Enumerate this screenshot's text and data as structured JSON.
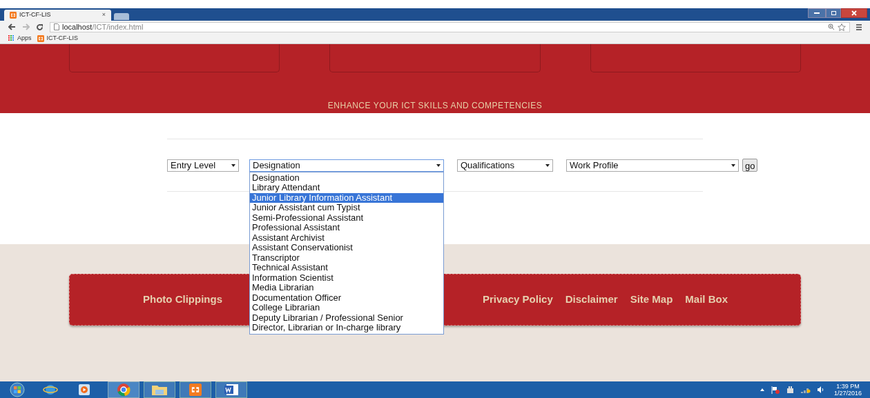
{
  "browser": {
    "tabs": [
      {
        "title": "ICT-CF-LIS",
        "close": "×",
        "selected": true
      },
      {
        "selected": false
      }
    ],
    "url_host": "localhost",
    "url_path": "/ICT/index.html",
    "bookmarks": [
      {
        "label": "Apps",
        "kind": "apps"
      },
      {
        "label": "ICT-CF-LIS",
        "kind": "site"
      }
    ]
  },
  "banner": {
    "tagline": "ENHANCE YOUR ICT SKILLS AND COMPETENCIES"
  },
  "filters": [
    {
      "value": "Entry Level",
      "expanded": false
    },
    {
      "value": "Designation",
      "expanded": true,
      "options": [
        {
          "label": "Designation",
          "highlighted": false
        },
        {
          "label": "Library Attendant",
          "highlighted": false
        },
        {
          "label": "Junior Library Information Assistant",
          "highlighted": true
        },
        {
          "label": "Junior Assistant cum Typist",
          "highlighted": false
        },
        {
          "label": "Semi-Professional Assistant",
          "highlighted": false
        },
        {
          "label": "Professional Assistant",
          "highlighted": false
        },
        {
          "label": "Assistant Archivist",
          "highlighted": false
        },
        {
          "label": "Assistant Conservationist",
          "highlighted": false
        },
        {
          "label": "Transcriptor",
          "highlighted": false
        },
        {
          "label": "Technical Assistant",
          "highlighted": false
        },
        {
          "label": "Information Scientist",
          "highlighted": false
        },
        {
          "label": "Media Librarian",
          "highlighted": false
        },
        {
          "label": "Documentation Officer",
          "highlighted": false
        },
        {
          "label": "College Librarian",
          "highlighted": false
        },
        {
          "label": "Deputy Librarian / Professional Senior",
          "highlighted": false
        },
        {
          "label": "Director, Librarian or In-charge library",
          "highlighted": false
        }
      ]
    },
    {
      "value": "Qualifications",
      "expanded": false
    },
    {
      "value": "Work Profile",
      "expanded": false
    }
  ],
  "go_button": "go",
  "footer_links_left": [
    "Photo Clippings"
  ],
  "footer_links_right": [
    "Privacy Policy",
    "Disclaimer",
    "Site Map",
    "Mail Box"
  ],
  "taskbar": {
    "time": "1:39 PM",
    "date": "1/27/2016"
  }
}
